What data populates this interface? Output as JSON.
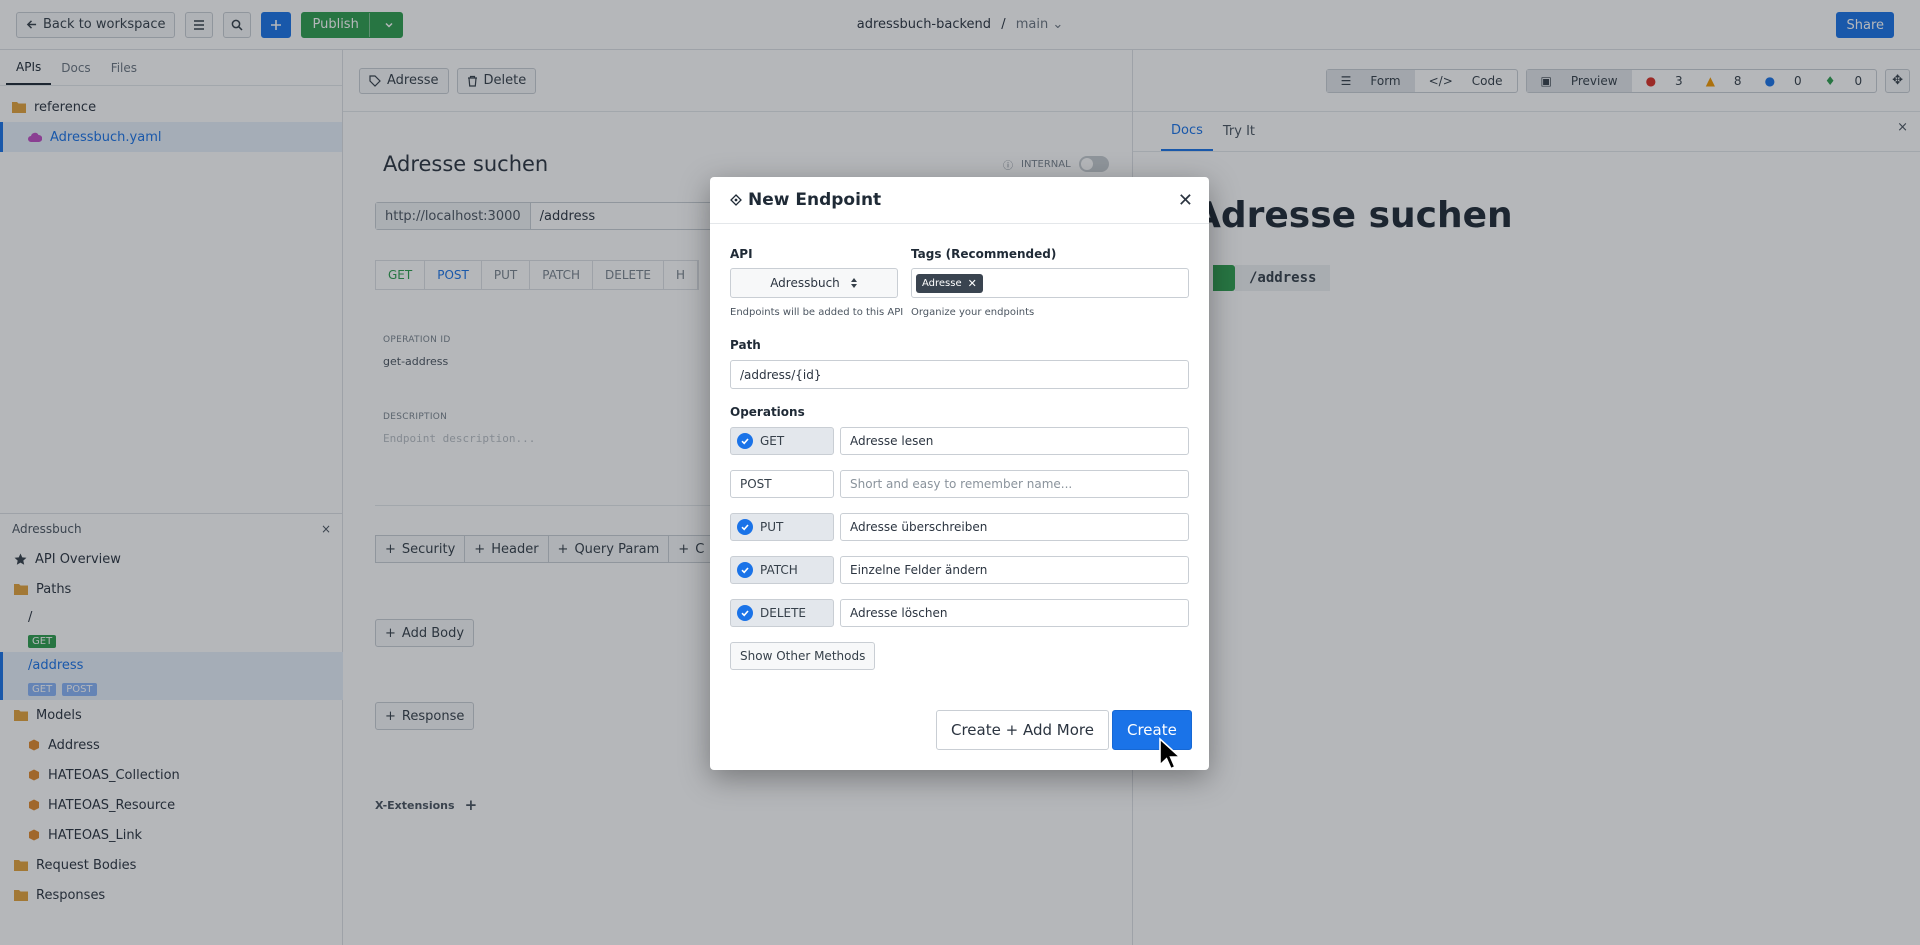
{
  "topbar": {
    "back_label": "Back to workspace",
    "publish_label": "Publish",
    "project": "adressbuch-backend",
    "separator": "/",
    "branch": "main",
    "share_label": "Share"
  },
  "left": {
    "tabs": [
      "APIs",
      "Docs",
      "Files"
    ],
    "tree": [
      {
        "label": "reference",
        "icon": "folder-icon"
      },
      {
        "label": "Adressbuch.yaml",
        "icon": "cloud-icon"
      }
    ],
    "panel_title": "Adressbuch",
    "nav": {
      "overview": "API Overview",
      "paths": "Paths",
      "path_root": "/",
      "path_root_methods": [
        "GET"
      ],
      "path_address": "/address",
      "path_address_methods": [
        "GET",
        "POST"
      ],
      "models": "Models",
      "model_items": [
        "Address",
        "HATEOAS_Collection",
        "HATEOAS_Resource",
        "HATEOAS_Link"
      ],
      "request_bodies": "Request Bodies",
      "responses": "Responses"
    }
  },
  "middle": {
    "tag_label": "Adresse",
    "delete_label": "Delete",
    "title": "Adresse suchen",
    "internal_label": "INTERNAL",
    "base_url": "http://localhost:3000",
    "path": "/address",
    "methods": [
      "GET",
      "POST",
      "PUT",
      "PATCH",
      "DELETE",
      "H"
    ],
    "operation_id_label": "OPERATION ID",
    "operation_id": "get-address",
    "description_label": "DESCRIPTION",
    "description_placeholder": "Endpoint description...",
    "add_buttons": [
      "Security",
      "Header",
      "Query Param",
      "C"
    ],
    "add_body": "Add Body",
    "response": "Response",
    "x_extensions": "X-Extensions"
  },
  "right": {
    "form_label": "Form",
    "code_label": "Code",
    "preview_label": "Preview",
    "counts": {
      "errors": "3",
      "warnings": "8",
      "info": "0",
      "hints": "0"
    },
    "tabs": [
      "Docs",
      "Try It"
    ],
    "doc_title": "Adresse suchen",
    "doc_path": "/address"
  },
  "modal": {
    "title": "New Endpoint",
    "api_label": "API",
    "api_value": "Adressbuch",
    "api_help": "Endpoints will be added to this API",
    "tags_label": "Tags (Recommended)",
    "tag_chip": "Adresse",
    "tags_help": "Organize your endpoints",
    "path_label": "Path",
    "path_value": "/address/{id}",
    "operations_label": "Operations",
    "operations": [
      {
        "method": "GET",
        "checked": true,
        "name": "Adresse lesen",
        "placeholder": ""
      },
      {
        "method": "POST",
        "checked": false,
        "name": "",
        "placeholder": "Short and easy to remember name..."
      },
      {
        "method": "PUT",
        "checked": true,
        "name": "Adresse überschreiben",
        "placeholder": ""
      },
      {
        "method": "PATCH",
        "checked": true,
        "name": "Einzelne Felder ändern",
        "placeholder": ""
      },
      {
        "method": "DELETE",
        "checked": true,
        "name": "Adresse löschen",
        "placeholder": ""
      }
    ],
    "show_other": "Show Other Methods",
    "create_more": "Create + Add More",
    "create": "Create"
  },
  "colors": {
    "accent": "#1a73e8",
    "publish_green": "#2e9e4f",
    "error": "#d93025",
    "warning": "#f29900",
    "info": "#1a73e8",
    "hint": "#2e9e4f"
  }
}
